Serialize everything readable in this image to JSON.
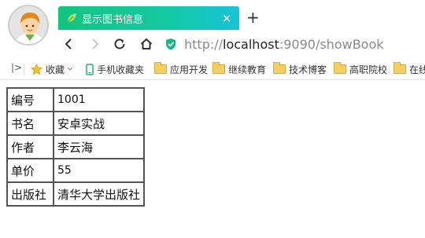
{
  "tab": {
    "title": "显示图书信息",
    "close": "×"
  },
  "newtab": "+",
  "address": {
    "scheme": "http://",
    "host": "localhost",
    "rest": ":9090/showBook"
  },
  "bookmarks": {
    "toggle": "|>",
    "items": [
      {
        "label": "收藏",
        "icon": "star-icon"
      },
      {
        "label": "手机收藏夹",
        "icon": "phone-icon"
      },
      {
        "label": "应用开发",
        "icon": "folder-icon"
      },
      {
        "label": "继续教育",
        "icon": "folder-icon"
      },
      {
        "label": "技术博客",
        "icon": "folder-icon"
      },
      {
        "label": "高职院校",
        "icon": "folder-icon"
      },
      {
        "label": "在线",
        "icon": "folder-icon"
      }
    ]
  },
  "book": {
    "rows": [
      {
        "key": "编号",
        "value": "1001"
      },
      {
        "key": "书名",
        "value": "安卓实战"
      },
      {
        "key": "作者",
        "value": "李云海"
      },
      {
        "key": "单价",
        "value": "55"
      },
      {
        "key": "出版社",
        "value": "清华大学出版社"
      }
    ]
  }
}
